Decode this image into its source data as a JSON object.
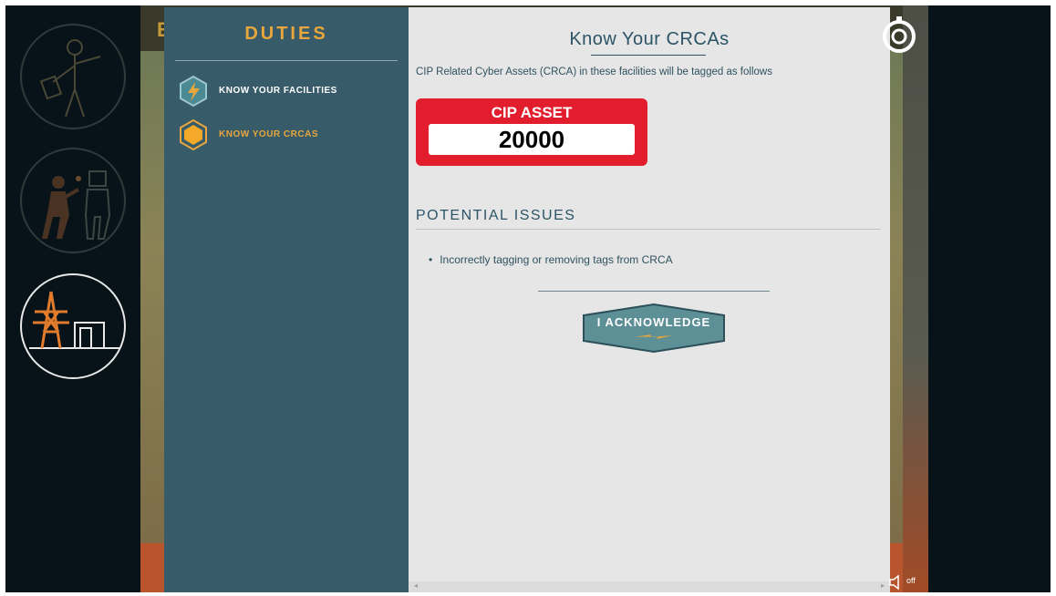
{
  "duties": {
    "title": "DUTIES",
    "items": [
      {
        "label": "KNOW YOUR FACILITIES",
        "icon": "lightning-hex-icon"
      },
      {
        "label": "KNOW YOUR CRCAS",
        "icon": "orange-hexagon-icon"
      }
    ]
  },
  "content": {
    "title": "Know Your CRCAs",
    "intro": "CIP Related Cyber Assets (CRCA) in these facilities will be tagged as follows",
    "asset_tag": {
      "label": "CIP ASSET",
      "number": "20000"
    },
    "issues_heading": "POTENTIAL ISSUES",
    "issues": [
      "Incorrectly tagging or removing tags from CRCA"
    ],
    "acknowledge_label": "I ACKNOWLEDGE"
  },
  "background": {
    "partial_letter": "E"
  },
  "sound": {
    "label": "off"
  },
  "colors": {
    "accent_orange": "#e8a63c",
    "panel_blue": "#375b69",
    "tag_red": "#e21d2d",
    "button_teal": "#5d8f97"
  },
  "rail": {
    "roles": [
      {
        "icon": "inspector-person-icon",
        "active": false
      },
      {
        "icon": "technician-person-icon",
        "active": false
      },
      {
        "icon": "power-tower-facility-icon",
        "active": true
      }
    ]
  }
}
